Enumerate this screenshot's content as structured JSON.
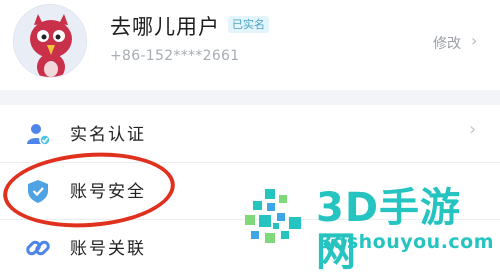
{
  "profile": {
    "username": "去哪儿用户",
    "verified_badge": "已实名",
    "phone": "+86-152****2661",
    "edit_label": "修改",
    "edit_chevron": "›",
    "avatar_icon": "bird-cartoon-avatar"
  },
  "menu": {
    "items": [
      {
        "label": "实名认证",
        "icon": "user-verify-icon",
        "chevron": "›"
      },
      {
        "label": "账号安全",
        "icon": "shield-icon",
        "chevron": ""
      },
      {
        "label": "账号关联",
        "icon": "link-icon",
        "chevron": ""
      }
    ]
  },
  "watermark": {
    "brand": "3D手游网",
    "url": "3dshouyou.com",
    "color": "#26c4c0"
  },
  "colors": {
    "accent_blue": "#4aa6c9",
    "highlight_red": "#e0301e"
  }
}
